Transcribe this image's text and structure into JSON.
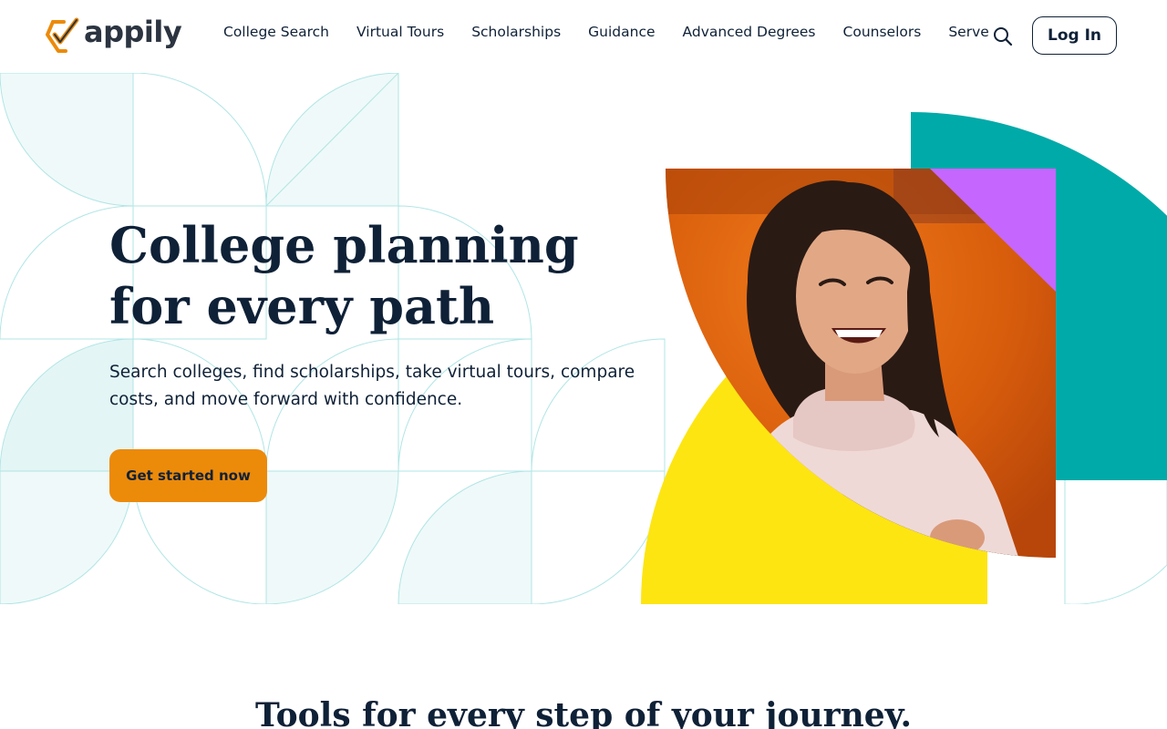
{
  "brand": {
    "name": "appily",
    "check_color": "#ec8a0a",
    "text_color": "#2b3440"
  },
  "nav": {
    "items": [
      {
        "label": "College Search"
      },
      {
        "label": "Virtual Tours"
      },
      {
        "label": "Scholarships"
      },
      {
        "label": "Guidance"
      },
      {
        "label": "Advanced Degrees"
      },
      {
        "label": "Counselors"
      },
      {
        "label": "Serve"
      }
    ],
    "search_icon": "search-icon",
    "login_label": "Log In"
  },
  "hero": {
    "title_line1": "College planning",
    "title_line2": "for every path",
    "subtitle": "Search colleges, find scholarships, take virtual tours, compare costs, and move forward with confidence.",
    "cta_label": "Get started now",
    "colors": {
      "teal": "#00aaa8",
      "yellow": "#fde512",
      "orange": "#e86a10",
      "purple": "#c566ff",
      "cta": "#ec8a0a",
      "text": "#0f2137",
      "pattern_line": "#a9e3e3",
      "pattern_fill": "#eef9f9"
    }
  },
  "tools": {
    "title": "Tools for every step of your journey."
  }
}
